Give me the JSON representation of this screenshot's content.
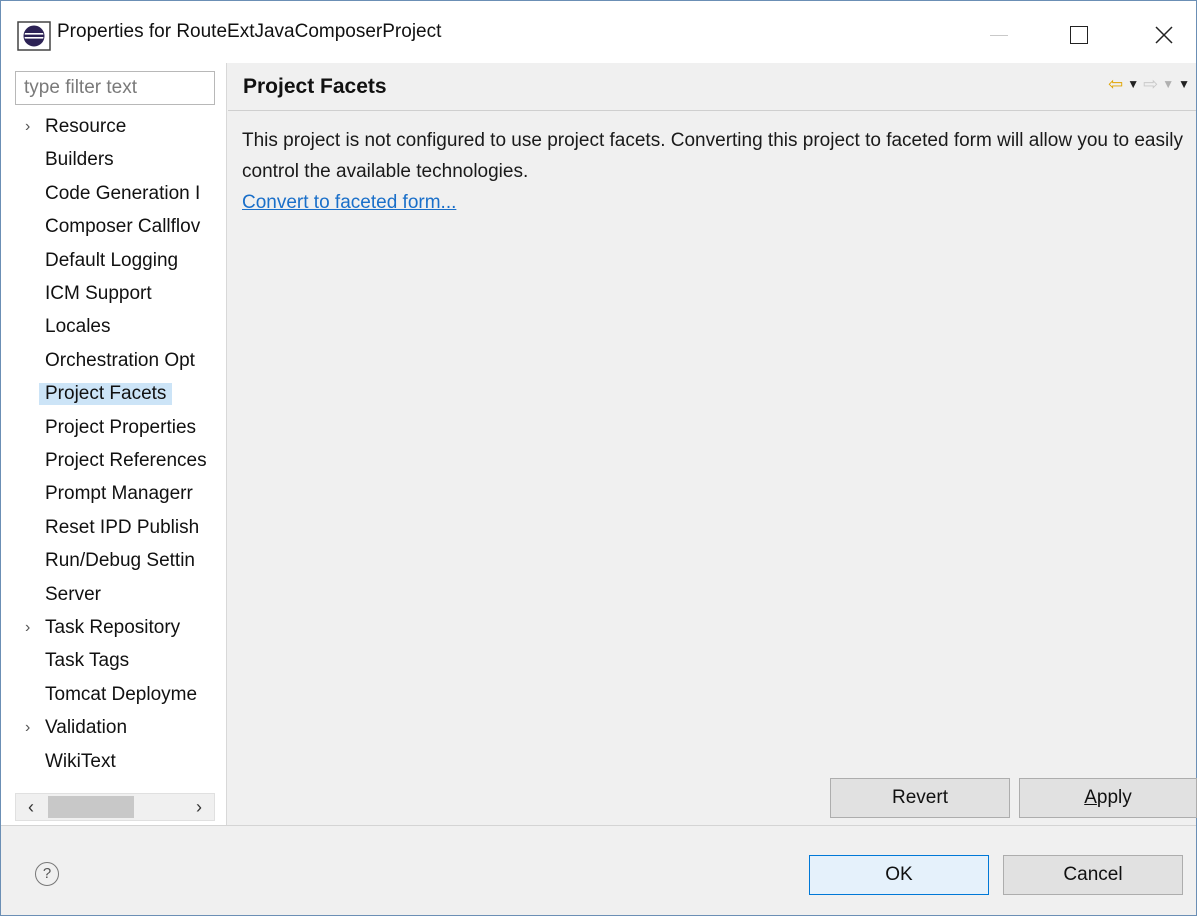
{
  "window": {
    "title": "Properties for RouteExtJavaComposerProject",
    "minimize_glyph": "—",
    "close_glyph": "✕"
  },
  "left_panel": {
    "filter_placeholder": "type filter text",
    "tree": [
      {
        "label": "Resource",
        "expandable": true
      },
      {
        "label": "Builders",
        "expandable": false
      },
      {
        "label": "Code Generation I",
        "expandable": false
      },
      {
        "label": "Composer Callflov",
        "expandable": false
      },
      {
        "label": "Default Logging",
        "expandable": false
      },
      {
        "label": "ICM Support",
        "expandable": false
      },
      {
        "label": "Locales",
        "expandable": false
      },
      {
        "label": "Orchestration Opt",
        "expandable": false
      },
      {
        "label": "Project Facets",
        "expandable": false,
        "selected": true
      },
      {
        "label": "Project Properties",
        "expandable": false
      },
      {
        "label": "Project References",
        "expandable": false
      },
      {
        "label": "Prompt Managerr",
        "expandable": false
      },
      {
        "label": "Reset IPD Publish",
        "expandable": false
      },
      {
        "label": "Run/Debug Settin",
        "expandable": false
      },
      {
        "label": "Server",
        "expandable": false
      },
      {
        "label": "Task Repository",
        "expandable": true
      },
      {
        "label": "Task Tags",
        "expandable": false
      },
      {
        "label": "Tomcat Deployme",
        "expandable": false
      },
      {
        "label": "Validation",
        "expandable": true
      },
      {
        "label": "WikiText",
        "expandable": false
      }
    ],
    "scroll_left": "‹",
    "scroll_right": "›"
  },
  "right_panel": {
    "title": "Project Facets",
    "description": "This project is not configured to use project facets. Converting this project to faceted form will allow you to easily control the available technologies.",
    "convert_link": "Convert to faceted form...",
    "revert_label": "Revert",
    "apply_label": "Apply"
  },
  "bottom": {
    "help_glyph": "?",
    "ok_label": "OK",
    "cancel_label": "Cancel"
  },
  "colors": {
    "selection": "#cce4f7",
    "link": "#1a6fc9",
    "back_arrow": "#e0a400",
    "ok_border": "#0078d7"
  }
}
